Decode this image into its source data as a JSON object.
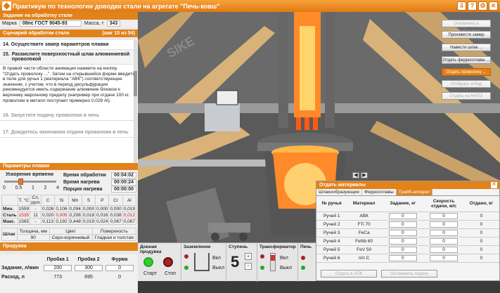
{
  "window": {
    "title": "Практикум по технологии доводки стали на агрегате \"Печь-ковш\"",
    "buttons": [
      "⇩",
      "?",
      "⚙",
      "✕"
    ]
  },
  "task": {
    "header": "Задание на обработку стали",
    "mark_label": "Марка",
    "mark_value": "08пс ГОСТ 9045-93",
    "mass_label": "Масса, т",
    "mass_value": "343"
  },
  "scenario": {
    "header": "Сценарий обработки стали",
    "step_counter": "(шаг 15 из 54)",
    "steps": [
      {
        "n": "14. Осуществите замер параметров плавки"
      },
      {
        "n": "15.",
        "t": "Раскислите поверхностный шлак алюминиевой проволокой"
      },
      {
        "n": "16. Запустите подачу проволоки в печь"
      },
      {
        "n": "17. Дождитесь окончания отдачи проволоки в печь"
      }
    ],
    "text": "В правой части области анимации нажмите на кнопку \"Отдать проволоку ...\". Затем на открывшейся форме введите в поле для ручья 1 (материала \"АВК\") соответствующее значение, с учетом, что в период десульфурации рекомендуется иметь содержание алюминия близкое к верхнему марочному пределу (например при отдаче 100 кг. проволоки в металл поступает примерно 0,028 Al)."
  },
  "params": {
    "header": "Параметры плавки",
    "accel_label": "Ускорение времени",
    "ticks": [
      "0",
      "0.5",
      "1",
      "2",
      "4"
    ],
    "time_rows": [
      {
        "l": "Время обработки",
        "v": "00:04:02"
      },
      {
        "l": "Время нагрева",
        "v": "00:00:24"
      },
      {
        "l": "Порция нагрева",
        "v": "00:00:00"
      }
    ],
    "chem_head": [
      "T, °C",
      "Сл, ppm",
      "C",
      "Si",
      "Mn",
      "S",
      "P",
      "Cr",
      "Al"
    ],
    "chem_rows": [
      {
        "l": "Мин.",
        "v": [
          "1559",
          "-",
          "0,026",
          "0,106",
          "0,094",
          "0,000",
          "0,000",
          "0,000",
          "0,019"
        ]
      },
      {
        "l": "Сталь",
        "v": [
          "1535",
          "11",
          "0,020",
          "0,005",
          "0,208",
          "0,018",
          "0,016",
          "0,038",
          "0,012"
        ]
      },
      {
        "l": "Макс.",
        "v": [
          "1565",
          "-",
          "0,113",
          "0,192",
          "0,448",
          "0,019",
          "0,024",
          "0,067",
          "0,067"
        ]
      }
    ],
    "slag_label": "Шлак",
    "slag_head": [
      "Толщина, мм",
      "Цвет",
      "Поверхность"
    ],
    "slag_vals": [
      "90",
      "Серо-коричневый",
      "Гладкая и толстая"
    ]
  },
  "prod": {
    "header": "Продувка",
    "cols": [
      "Пробка 1",
      "Пробка 2",
      "Фурма"
    ],
    "rows": [
      {
        "l": "Задание, л/мин",
        "v": [
          "200",
          "300",
          "0"
        ]
      },
      {
        "l": "Расход, л",
        "v": [
          "773",
          "695",
          "0"
        ]
      }
    ]
  },
  "bottom": {
    "sections": [
      "Донная продувка",
      "Заземление",
      "Ступень",
      "Трансформатор",
      "Печь"
    ],
    "start": "Старт",
    "stop": "Стоп",
    "on": "Вкл",
    "off": "Выкл",
    "stage": "5"
  },
  "actions": [
    "Отключить и опломбировать",
    "Произвести замер",
    "Навести шлак ...",
    "Отдать ферросплавы ...",
    "Отдать проволоку ...",
    "Отобрать отбор",
    "Отдать на МНЛЗ"
  ],
  "materials": {
    "header": "Отдать материалы",
    "tabs": [
      "Шлакообразующие",
      "Ферросплавы",
      "Трайб-аппарат"
    ],
    "head": [
      "№ ручья",
      "Материал",
      "Задание, кг",
      "Скорость отдачи, м/с",
      "Отдано, кг"
    ],
    "rows": [
      {
        "n": "Ручей 1",
        "m": "АВК",
        "z": "0",
        "s": "0",
        "o": "0"
      },
      {
        "n": "Ручей 2",
        "m": "FTi 70",
        "z": "0",
        "s": "0",
        "o": "0"
      },
      {
        "n": "Ручей 3",
        "m": "FeCa",
        "z": "0",
        "s": "0",
        "o": "0"
      },
      {
        "n": "Ручей 4",
        "m": "FeNb 60",
        "z": "0",
        "s": "0",
        "o": "0"
      },
      {
        "n": "Ручей 5",
        "m": "FeV 50",
        "z": "0",
        "s": "0",
        "o": "0"
      },
      {
        "n": "Ручей 6",
        "m": "п/п С",
        "z": "0",
        "s": "0",
        "o": "0"
      }
    ],
    "btn_give": "Отдать в АПК",
    "btn_stop": "Остановить подачу"
  },
  "watermark": "SIKE",
  "colors": {
    "accent": "#e2821a",
    "flame": "#ff7a1a"
  }
}
